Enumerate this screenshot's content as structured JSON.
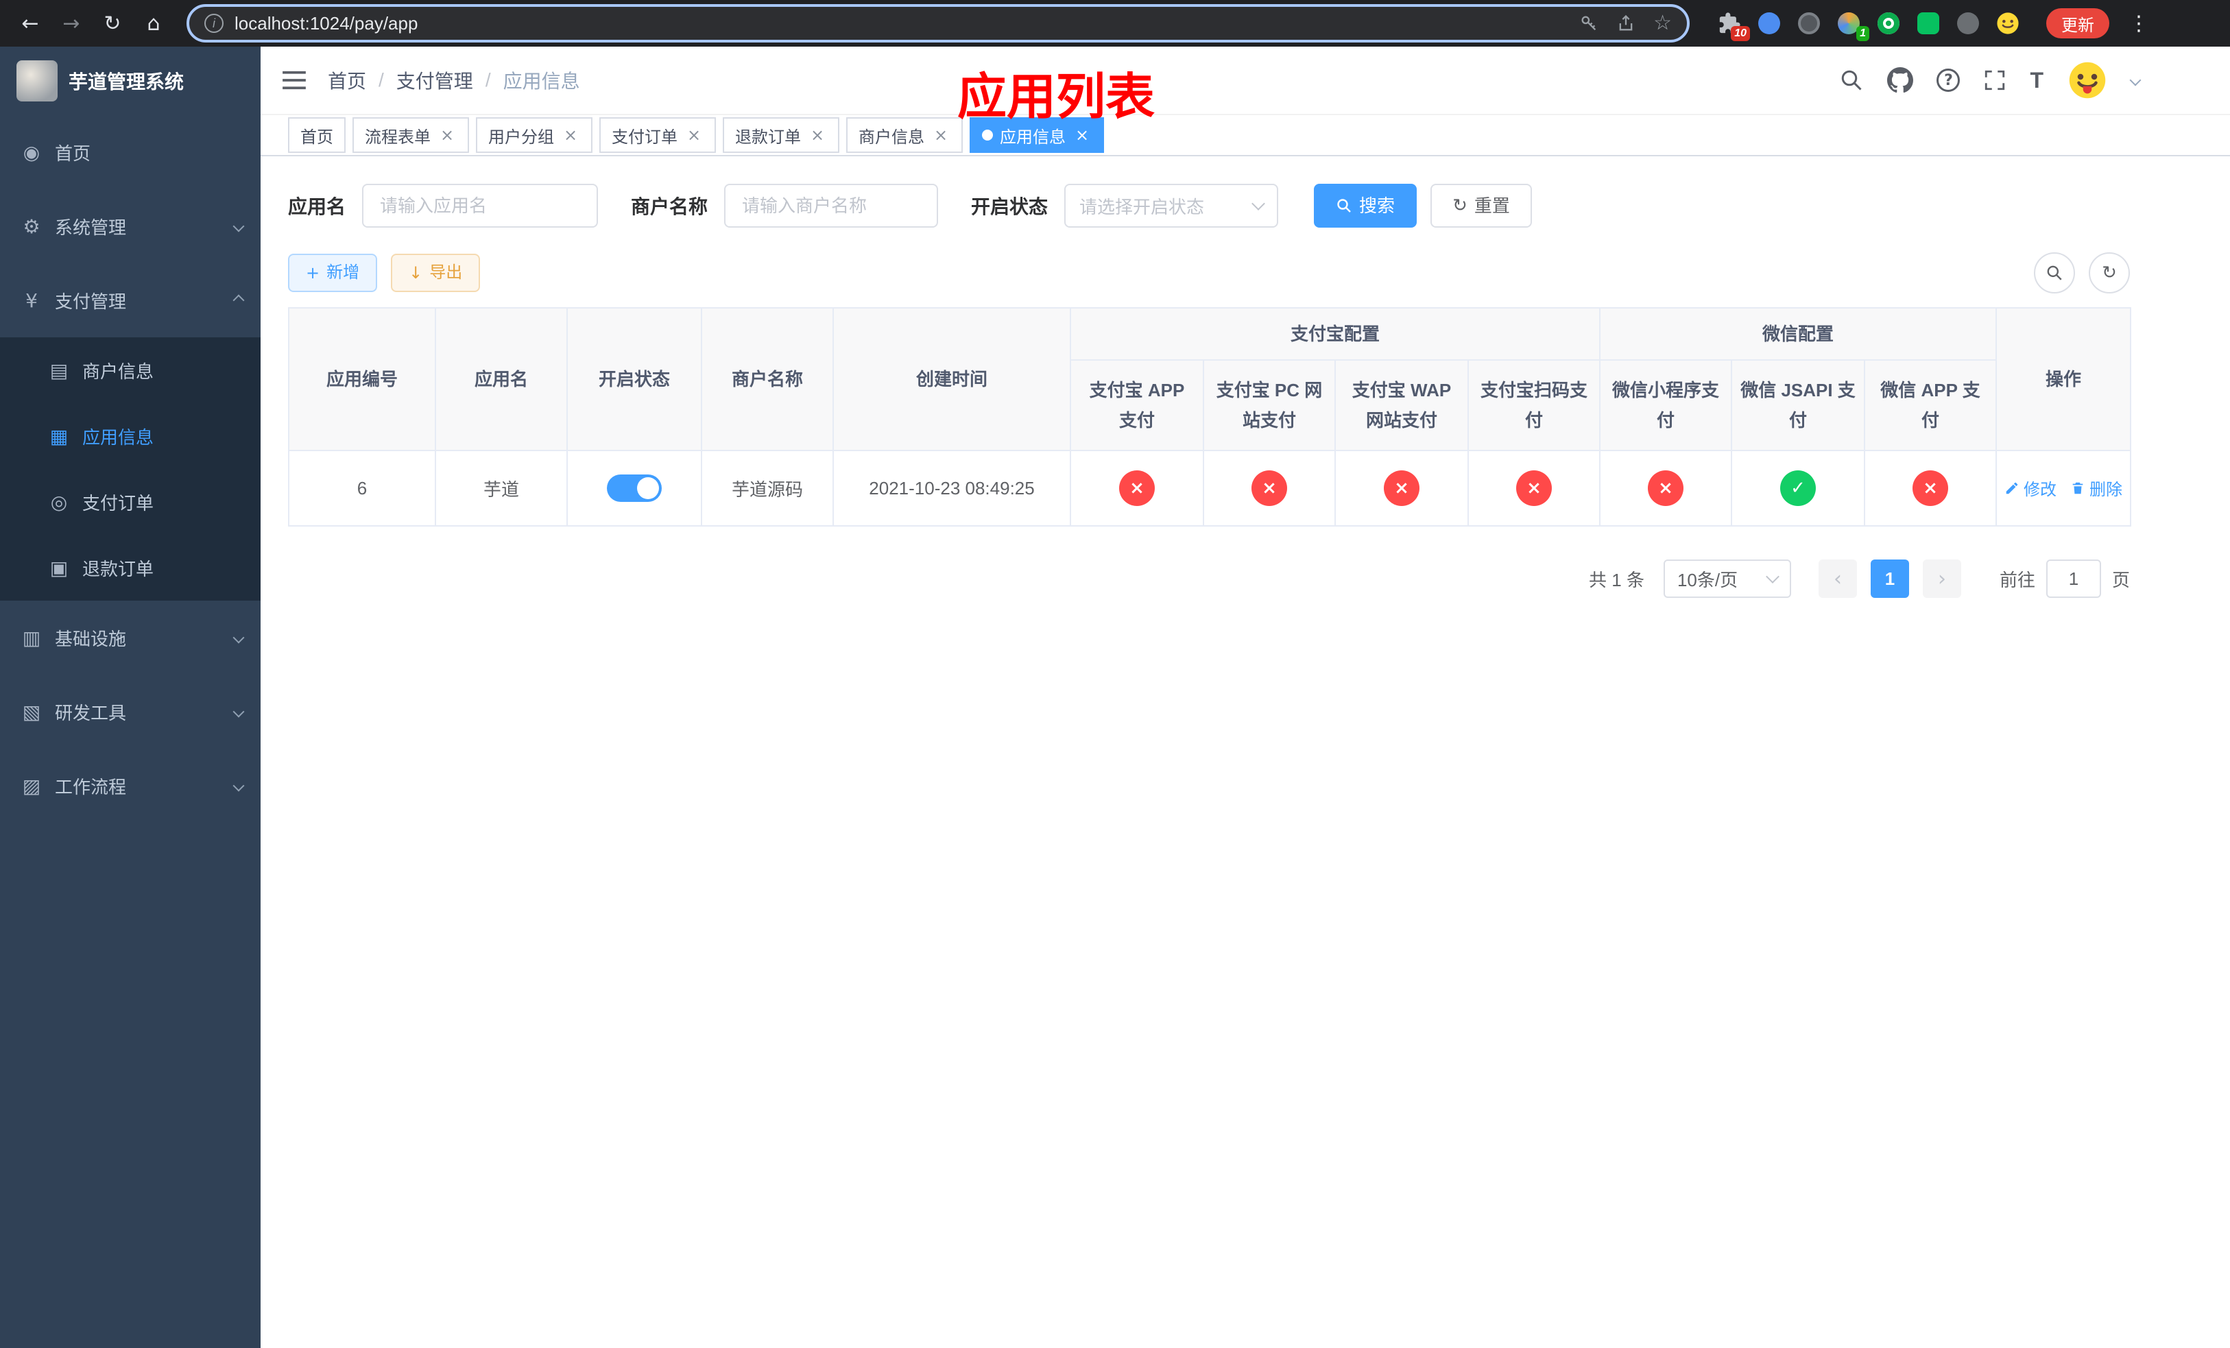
{
  "browser": {
    "url": "localhost:1024/pay/app",
    "update_label": "更新",
    "extension_badges": {
      "puzzle": "10",
      "profile": "1"
    }
  },
  "annotation": {
    "text": "应用列表"
  },
  "sidebar": {
    "title": "芋道管理系统",
    "menu": {
      "home": "首页",
      "system": "系统管理",
      "payment": "支付管理",
      "merchant_info": "商户信息",
      "app_info": "应用信息",
      "pay_order": "支付订单",
      "refund_order": "退款订单",
      "infra": "基础设施",
      "dev_tools": "研发工具",
      "workflow": "工作流程"
    }
  },
  "header": {
    "breadcrumb": [
      "首页",
      "支付管理",
      "应用信息"
    ]
  },
  "tags": [
    {
      "label": "首页",
      "closable": false,
      "active": false
    },
    {
      "label": "流程表单",
      "closable": true,
      "active": false
    },
    {
      "label": "用户分组",
      "closable": true,
      "active": false
    },
    {
      "label": "支付订单",
      "closable": true,
      "active": false
    },
    {
      "label": "退款订单",
      "closable": true,
      "active": false
    },
    {
      "label": "商户信息",
      "closable": true,
      "active": false
    },
    {
      "label": "应用信息",
      "closable": true,
      "active": true
    }
  ],
  "filters": {
    "app_name_label": "应用名",
    "app_name_placeholder": "请输入应用名",
    "merchant_label": "商户名称",
    "merchant_placeholder": "请输入商户名称",
    "status_label": "开启状态",
    "status_placeholder": "请选择开启状态",
    "search_label": "搜索",
    "reset_label": "重置"
  },
  "toolbar": {
    "add_label": "新增",
    "export_label": "导出"
  },
  "table": {
    "groups": {
      "alipay": "支付宝配置",
      "wechat": "微信配置"
    },
    "columns": [
      "应用编号",
      "应用名",
      "开启状态",
      "商户名称",
      "创建时间",
      "支付宝 APP 支付",
      "支付宝 PC 网站支付",
      "支付宝 WAP 网站支付",
      "支付宝扫码支付",
      "微信小程序支付",
      "微信 JSAPI 支付",
      "微信 APP 支付",
      "操作"
    ],
    "rows": [
      {
        "id": "6",
        "name": "芋道",
        "enabled": true,
        "merchant": "芋道源码",
        "created": "2021-10-23 08:49:25",
        "status": {
          "alipay_app": false,
          "alipay_pc": false,
          "alipay_wap": false,
          "alipay_qr": false,
          "wx_mini": false,
          "wx_jsapi": true,
          "wx_app": false
        },
        "actions": [
          "修改",
          "删除"
        ]
      }
    ]
  },
  "pagination": {
    "total_label": "共 1 条",
    "page_size": "10条/页",
    "current_page": "1",
    "goto_label": "前往",
    "goto_value": "1",
    "page_unit": "页"
  },
  "icons": {
    "back": "←",
    "forward": "→",
    "reload": "↻",
    "home": "⌂",
    "bookmark": "☆",
    "menu-dots": "⋮",
    "info": "i",
    "dashboard": "◉",
    "gear": "⚙",
    "yen": "¥",
    "merchant": "▤",
    "app": "▦",
    "order": "◎",
    "refund": "▣",
    "infra": "▥",
    "tools": "▧",
    "workflow": "▨",
    "plus": "+",
    "download": "↓",
    "refresh": "↻",
    "check": "✓",
    "cross": "×",
    "close": "×",
    "help": "?",
    "font-size": "T"
  },
  "colors": {
    "accent": "#409eff",
    "danger": "#ff4949",
    "success": "#13ce66",
    "warning": "#e6a23c",
    "annotation": "#ff0000"
  }
}
